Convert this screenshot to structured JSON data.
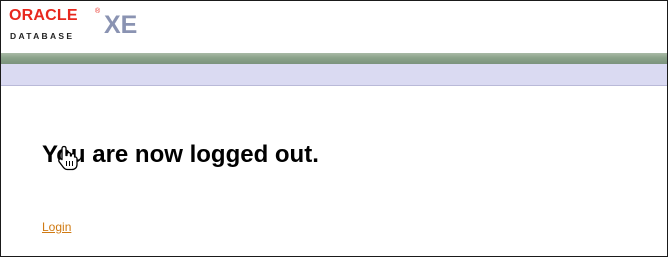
{
  "brand": {
    "oracle": "ORACLE",
    "registered": "®",
    "database": "DATABASE",
    "edition": "XE",
    "colors": {
      "oracle_red": "#e8281e",
      "xe_gray_blue": "#8a93b2"
    }
  },
  "bands": {
    "green": "#8aa28a",
    "lavender": "#dadaf2"
  },
  "main": {
    "message": "You are now logged out.",
    "login_link": "Login",
    "link_color": "#d07a12"
  },
  "cursor": {
    "icon": "hand-pointer-icon"
  }
}
